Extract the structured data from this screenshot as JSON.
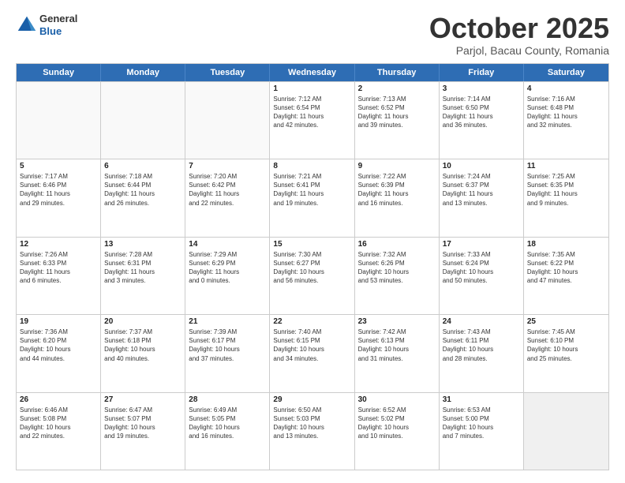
{
  "header": {
    "logo_general": "General",
    "logo_blue": "Blue",
    "month_title": "October 2025",
    "location": "Parjol, Bacau County, Romania"
  },
  "days_of_week": [
    "Sunday",
    "Monday",
    "Tuesday",
    "Wednesday",
    "Thursday",
    "Friday",
    "Saturday"
  ],
  "weeks": [
    [
      {
        "day": "",
        "info": ""
      },
      {
        "day": "",
        "info": ""
      },
      {
        "day": "",
        "info": ""
      },
      {
        "day": "1",
        "info": "Sunrise: 7:12 AM\nSunset: 6:54 PM\nDaylight: 11 hours\nand 42 minutes."
      },
      {
        "day": "2",
        "info": "Sunrise: 7:13 AM\nSunset: 6:52 PM\nDaylight: 11 hours\nand 39 minutes."
      },
      {
        "day": "3",
        "info": "Sunrise: 7:14 AM\nSunset: 6:50 PM\nDaylight: 11 hours\nand 36 minutes."
      },
      {
        "day": "4",
        "info": "Sunrise: 7:16 AM\nSunset: 6:48 PM\nDaylight: 11 hours\nand 32 minutes."
      }
    ],
    [
      {
        "day": "5",
        "info": "Sunrise: 7:17 AM\nSunset: 6:46 PM\nDaylight: 11 hours\nand 29 minutes."
      },
      {
        "day": "6",
        "info": "Sunrise: 7:18 AM\nSunset: 6:44 PM\nDaylight: 11 hours\nand 26 minutes."
      },
      {
        "day": "7",
        "info": "Sunrise: 7:20 AM\nSunset: 6:42 PM\nDaylight: 11 hours\nand 22 minutes."
      },
      {
        "day": "8",
        "info": "Sunrise: 7:21 AM\nSunset: 6:41 PM\nDaylight: 11 hours\nand 19 minutes."
      },
      {
        "day": "9",
        "info": "Sunrise: 7:22 AM\nSunset: 6:39 PM\nDaylight: 11 hours\nand 16 minutes."
      },
      {
        "day": "10",
        "info": "Sunrise: 7:24 AM\nSunset: 6:37 PM\nDaylight: 11 hours\nand 13 minutes."
      },
      {
        "day": "11",
        "info": "Sunrise: 7:25 AM\nSunset: 6:35 PM\nDaylight: 11 hours\nand 9 minutes."
      }
    ],
    [
      {
        "day": "12",
        "info": "Sunrise: 7:26 AM\nSunset: 6:33 PM\nDaylight: 11 hours\nand 6 minutes."
      },
      {
        "day": "13",
        "info": "Sunrise: 7:28 AM\nSunset: 6:31 PM\nDaylight: 11 hours\nand 3 minutes."
      },
      {
        "day": "14",
        "info": "Sunrise: 7:29 AM\nSunset: 6:29 PM\nDaylight: 11 hours\nand 0 minutes."
      },
      {
        "day": "15",
        "info": "Sunrise: 7:30 AM\nSunset: 6:27 PM\nDaylight: 10 hours\nand 56 minutes."
      },
      {
        "day": "16",
        "info": "Sunrise: 7:32 AM\nSunset: 6:26 PM\nDaylight: 10 hours\nand 53 minutes."
      },
      {
        "day": "17",
        "info": "Sunrise: 7:33 AM\nSunset: 6:24 PM\nDaylight: 10 hours\nand 50 minutes."
      },
      {
        "day": "18",
        "info": "Sunrise: 7:35 AM\nSunset: 6:22 PM\nDaylight: 10 hours\nand 47 minutes."
      }
    ],
    [
      {
        "day": "19",
        "info": "Sunrise: 7:36 AM\nSunset: 6:20 PM\nDaylight: 10 hours\nand 44 minutes."
      },
      {
        "day": "20",
        "info": "Sunrise: 7:37 AM\nSunset: 6:18 PM\nDaylight: 10 hours\nand 40 minutes."
      },
      {
        "day": "21",
        "info": "Sunrise: 7:39 AM\nSunset: 6:17 PM\nDaylight: 10 hours\nand 37 minutes."
      },
      {
        "day": "22",
        "info": "Sunrise: 7:40 AM\nSunset: 6:15 PM\nDaylight: 10 hours\nand 34 minutes."
      },
      {
        "day": "23",
        "info": "Sunrise: 7:42 AM\nSunset: 6:13 PM\nDaylight: 10 hours\nand 31 minutes."
      },
      {
        "day": "24",
        "info": "Sunrise: 7:43 AM\nSunset: 6:11 PM\nDaylight: 10 hours\nand 28 minutes."
      },
      {
        "day": "25",
        "info": "Sunrise: 7:45 AM\nSunset: 6:10 PM\nDaylight: 10 hours\nand 25 minutes."
      }
    ],
    [
      {
        "day": "26",
        "info": "Sunrise: 6:46 AM\nSunset: 5:08 PM\nDaylight: 10 hours\nand 22 minutes."
      },
      {
        "day": "27",
        "info": "Sunrise: 6:47 AM\nSunset: 5:07 PM\nDaylight: 10 hours\nand 19 minutes."
      },
      {
        "day": "28",
        "info": "Sunrise: 6:49 AM\nSunset: 5:05 PM\nDaylight: 10 hours\nand 16 minutes."
      },
      {
        "day": "29",
        "info": "Sunrise: 6:50 AM\nSunset: 5:03 PM\nDaylight: 10 hours\nand 13 minutes."
      },
      {
        "day": "30",
        "info": "Sunrise: 6:52 AM\nSunset: 5:02 PM\nDaylight: 10 hours\nand 10 minutes."
      },
      {
        "day": "31",
        "info": "Sunrise: 6:53 AM\nSunset: 5:00 PM\nDaylight: 10 hours\nand 7 minutes."
      },
      {
        "day": "",
        "info": ""
      }
    ]
  ]
}
